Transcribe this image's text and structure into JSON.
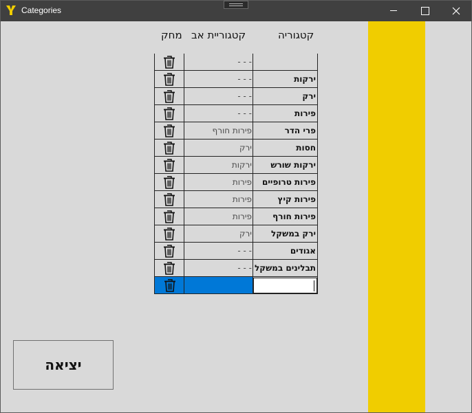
{
  "window": {
    "title": "Categories"
  },
  "colors": {
    "stripe": "#f0cd00",
    "selection": "#0078d7",
    "titlebar": "#404040"
  },
  "headers": {
    "category": "קטגוריה",
    "parent": "קטגוריית אב",
    "delete": "מחק"
  },
  "rows": [
    {
      "name": "",
      "parent": "- - -"
    },
    {
      "name": "ירקות",
      "parent": "- - -"
    },
    {
      "name": "ירק",
      "parent": "- - -"
    },
    {
      "name": "פירות",
      "parent": "- - -"
    },
    {
      "name": "פרי הדר",
      "parent": "פירות חורף"
    },
    {
      "name": "חסות",
      "parent": "ירק"
    },
    {
      "name": "ירקות שורש",
      "parent": "ירקות"
    },
    {
      "name": "פירות טרופיים",
      "parent": "פירות"
    },
    {
      "name": "פירות קיץ",
      "parent": "פירות"
    },
    {
      "name": "פירות חורף",
      "parent": "פירות"
    },
    {
      "name": "ירק במשקל",
      "parent": "ירק"
    },
    {
      "name": "אגודים",
      "parent": "- - -"
    },
    {
      "name": "תבלינים במשקל",
      "parent": "- - -"
    }
  ],
  "new_row": {
    "name_value": "",
    "parent_value": ""
  },
  "exit": {
    "label": "יציאה"
  },
  "icons": {
    "app": "app-logo-icon",
    "delete": "trash-icon"
  }
}
